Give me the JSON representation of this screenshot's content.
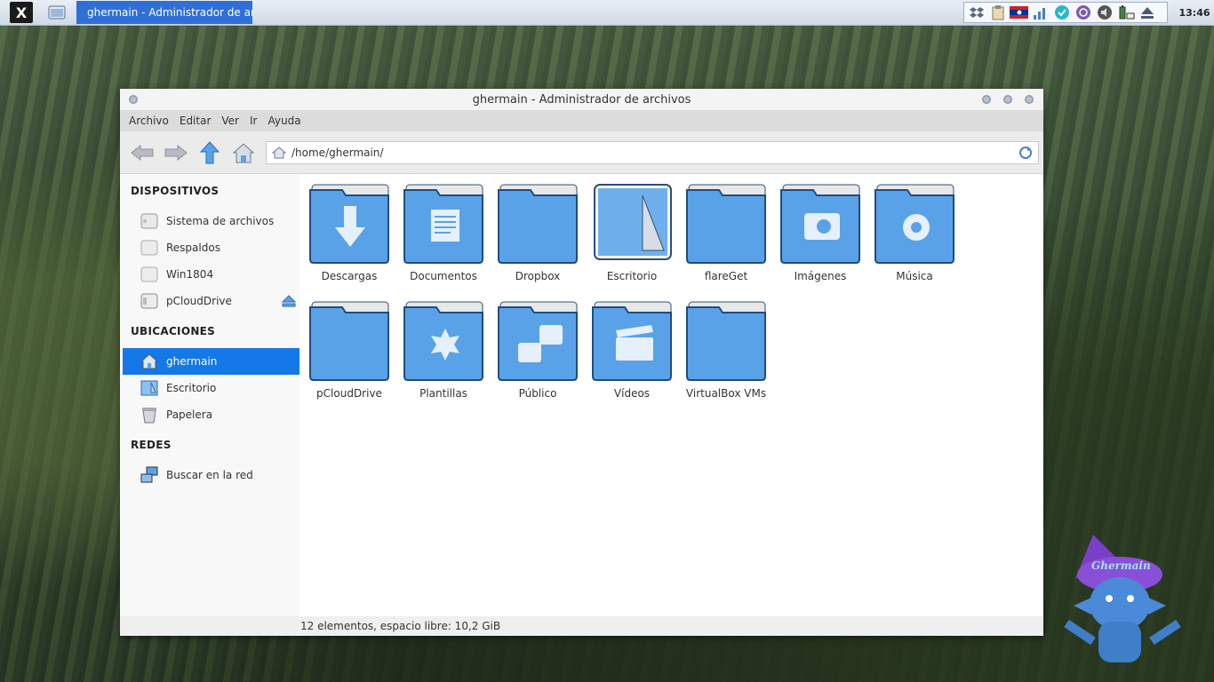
{
  "panel": {
    "launcher_label": "X",
    "task_title": "ghermain - Administrador de ar...",
    "clock": "13:46",
    "tray_icons": [
      "dropbox-icon",
      "clipboard-icon",
      "keyboard-flag-icon",
      "network-icon",
      "pcloud-icon",
      "viber-icon",
      "volume-icon",
      "battery-icon",
      "eject-icon"
    ]
  },
  "window": {
    "title": "ghermain - Administrador de archivos",
    "menu": [
      "Archivo",
      "Editar",
      "Ver",
      "Ir",
      "Ayuda"
    ],
    "path": "/home/ghermain/",
    "sidebar": {
      "devices_header": "DISPOSITIVOS",
      "devices": [
        "Sistema de archivos",
        "Respaldos",
        "Win1804",
        "pCloudDrive"
      ],
      "places_header": "UBICACIONES",
      "places": [
        "ghermain",
        "Escritorio",
        "Papelera"
      ],
      "network_header": "REDES",
      "network": [
        "Buscar en la red"
      ]
    },
    "folders": [
      "Descargas",
      "Documentos",
      "Dropbox",
      "Escritorio",
      "flareGet",
      "Imágenes",
      "Música",
      "pCloudDrive",
      "Plantillas",
      "Público",
      "Vídeos",
      "VirtualBox VMs"
    ],
    "status": "12 elementos, espacio libre: 10,2 GiB"
  },
  "desktop": {
    "mascot_text": "Ghermain"
  },
  "colors": {
    "selection": "#1478e8",
    "folder": "#5aa2e8",
    "taskbar_active": "#2f6fd8"
  }
}
